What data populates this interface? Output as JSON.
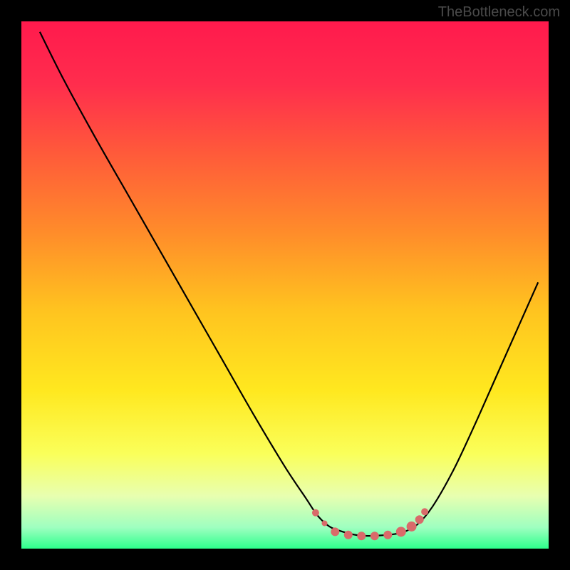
{
  "watermark": "TheBottleneck.com",
  "chart_data": {
    "type": "line",
    "title": "",
    "xlabel": "",
    "ylabel": "",
    "xlim": [
      0,
      100
    ],
    "ylim": [
      0,
      100
    ],
    "gradient_stops": [
      {
        "offset": 0,
        "color": "#ff1a4d"
      },
      {
        "offset": 12,
        "color": "#ff2d4d"
      },
      {
        "offset": 25,
        "color": "#ff5a3a"
      },
      {
        "offset": 40,
        "color": "#ff8c2a"
      },
      {
        "offset": 55,
        "color": "#ffc41f"
      },
      {
        "offset": 70,
        "color": "#ffe81f"
      },
      {
        "offset": 82,
        "color": "#faff5a"
      },
      {
        "offset": 90,
        "color": "#e8ffb0"
      },
      {
        "offset": 96,
        "color": "#9effc0"
      },
      {
        "offset": 100,
        "color": "#2dff8c"
      }
    ],
    "series": [
      {
        "name": "bottleneck-curve",
        "color": "#000000",
        "points": [
          {
            "x": 3.5,
            "y": 98.0
          },
          {
            "x": 8.0,
            "y": 89.0
          },
          {
            "x": 14.0,
            "y": 78.0
          },
          {
            "x": 20.0,
            "y": 67.5
          },
          {
            "x": 26.0,
            "y": 57.0
          },
          {
            "x": 32.0,
            "y": 46.5
          },
          {
            "x": 38.0,
            "y": 36.0
          },
          {
            "x": 44.0,
            "y": 25.5
          },
          {
            "x": 50.0,
            "y": 15.5
          },
          {
            "x": 54.0,
            "y": 9.5
          },
          {
            "x": 56.0,
            "y": 6.5
          },
          {
            "x": 58.0,
            "y": 4.5
          },
          {
            "x": 60.0,
            "y": 3.5
          },
          {
            "x": 64.0,
            "y": 2.5
          },
          {
            "x": 68.0,
            "y": 2.5
          },
          {
            "x": 72.0,
            "y": 3.0
          },
          {
            "x": 75.0,
            "y": 4.5
          },
          {
            "x": 78.0,
            "y": 8.0
          },
          {
            "x": 82.0,
            "y": 15.0
          },
          {
            "x": 86.0,
            "y": 23.5
          },
          {
            "x": 90.0,
            "y": 32.5
          },
          {
            "x": 94.0,
            "y": 41.5
          },
          {
            "x": 98.0,
            "y": 50.5
          }
        ]
      }
    ],
    "markers": {
      "color": "#d96a6a",
      "points": [
        {
          "x": 55.8,
          "y": 6.8,
          "r": 5
        },
        {
          "x": 57.5,
          "y": 4.8,
          "r": 4
        },
        {
          "x": 59.5,
          "y": 3.2,
          "r": 6
        },
        {
          "x": 62.0,
          "y": 2.6,
          "r": 6
        },
        {
          "x": 64.5,
          "y": 2.4,
          "r": 6
        },
        {
          "x": 67.0,
          "y": 2.4,
          "r": 6
        },
        {
          "x": 69.5,
          "y": 2.6,
          "r": 6
        },
        {
          "x": 72.0,
          "y": 3.2,
          "r": 7
        },
        {
          "x": 74.0,
          "y": 4.2,
          "r": 7
        },
        {
          "x": 75.5,
          "y": 5.5,
          "r": 6
        },
        {
          "x": 76.5,
          "y": 7.0,
          "r": 5
        }
      ]
    }
  }
}
